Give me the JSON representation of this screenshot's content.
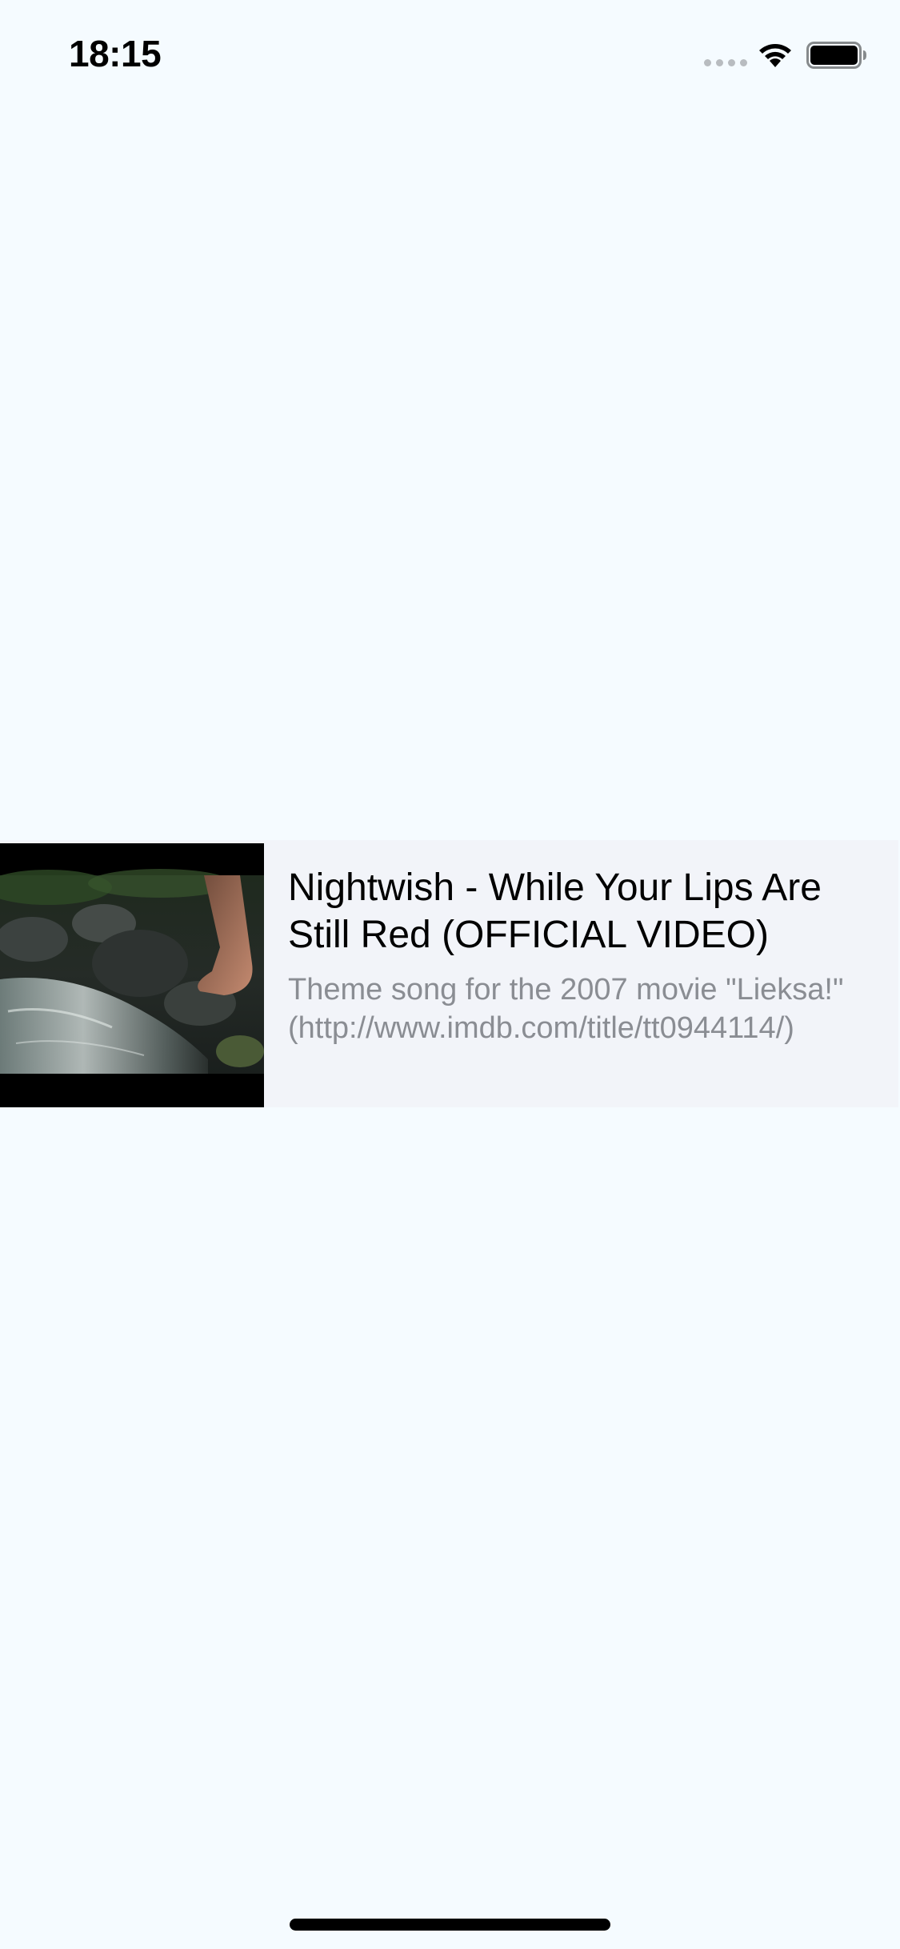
{
  "status_bar": {
    "time": "18:15",
    "icons": [
      "signal-icon",
      "wifi-icon",
      "battery-icon"
    ]
  },
  "video": {
    "title": "Nightwish - While Your Lips Are Still Red (OFFICIAL VIDEO)",
    "description": "Theme song for the 2007 movie \"Lieksa!\" (http://www.imdb.com/title/tt0944114/)",
    "thumbnail_icon": "video-thumbnail"
  },
  "colors": {
    "background": "#f5fbff",
    "row_background": "#f2f4f9",
    "title": "#000000",
    "description": "#8a8d93"
  }
}
